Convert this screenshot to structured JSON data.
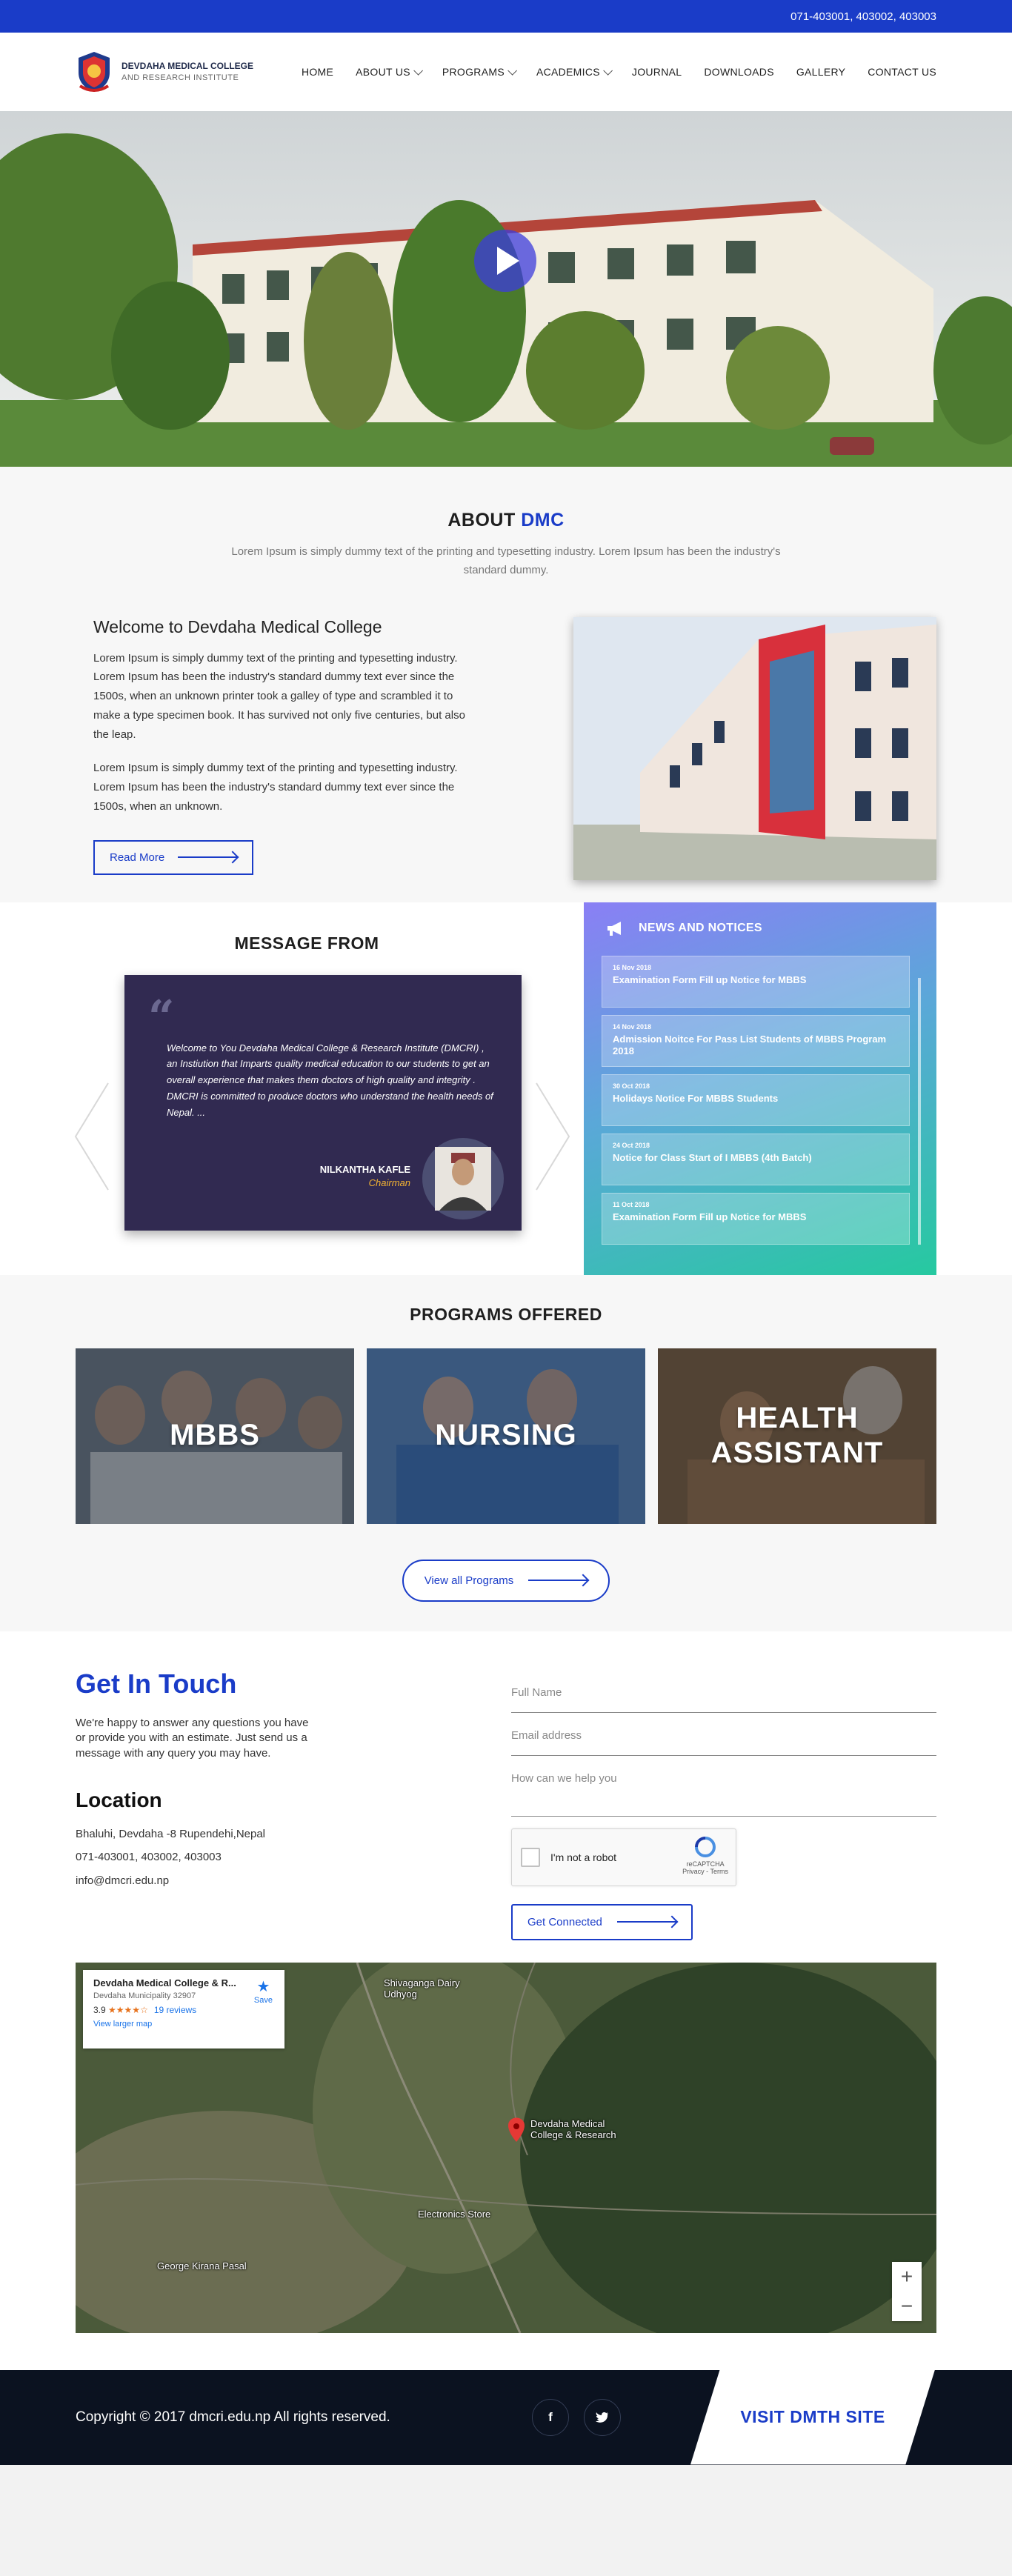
{
  "topbar": {
    "phone": "071-403001, 403002, 403003"
  },
  "header": {
    "logo_line1": "DEVDAHA MEDICAL COLLEGE",
    "logo_line2": "AND RESEARCH INSTITUTE",
    "nav": [
      {
        "label": "HOME",
        "dropdown": false
      },
      {
        "label": "ABOUT US",
        "dropdown": true
      },
      {
        "label": "PROGRAMS",
        "dropdown": true
      },
      {
        "label": "ACADEMICS",
        "dropdown": true
      },
      {
        "label": "JOURNAL",
        "dropdown": false
      },
      {
        "label": "DOWNLOADS",
        "dropdown": false
      },
      {
        "label": "GALLERY",
        "dropdown": false
      },
      {
        "label": "CONTACT US",
        "dropdown": false
      }
    ]
  },
  "about": {
    "title_prefix": "ABOUT",
    "title_highlight": "DMC",
    "subtitle": "Lorem Ipsum is simply dummy text of the printing and typesetting industry. Lorem Ipsum has been the industry's standard dummy.",
    "heading": "Welcome to Devdaha Medical College",
    "para1": "Lorem Ipsum is simply dummy text of the printing and typesetting industry. Lorem Ipsum has been the industry's standard dummy text ever since the 1500s, when an unknown printer took a galley of type and scrambled it to make a type specimen book. It has survived not only five centuries, but also the leap.",
    "para2": "Lorem Ipsum is simply dummy text of the printing and typesetting industry. Lorem Ipsum has been the industry's standard dummy text ever since the 1500s, when an unknown.",
    "read_more": "Read More"
  },
  "message": {
    "title": "MESSAGE FROM",
    "quote": "Welcome to You Devdaha Medical College & Research Institute (DMCRI) , an Instiution that Imparts  quality medical education to our students to get an overall experience that makes them doctors of high quality and integrity . DMCRI is committed to produce doctors who understand the health needs of Nepal. ...",
    "name": "NILKANTHA KAFLE",
    "role": "Chairman"
  },
  "news": {
    "title": "NEWS AND NOTICES",
    "items": [
      {
        "date": "16 Nov 2018",
        "title": "Examination Form Fill up Notice for MBBS"
      },
      {
        "date": "14 Nov 2018",
        "title": "Admission Noitce For Pass List Students of MBBS Program 2018"
      },
      {
        "date": "30 Oct 2018",
        "title": "Holidays Notice For MBBS Students"
      },
      {
        "date": "24 Oct 2018",
        "title": "Notice for Class Start of I MBBS (4th Batch)"
      },
      {
        "date": "11 Oct 2018",
        "title": "Examination Form Fill up Notice for MBBS"
      }
    ]
  },
  "programs": {
    "title": "PROGRAMS OFFERED",
    "items": [
      {
        "label": "MBBS",
        "tint": "#2f3a4a"
      },
      {
        "label": "NURSING",
        "tint": "#2c4a6e"
      },
      {
        "label": "HEALTH ASSISTANT",
        "tint": "#3a3024"
      }
    ],
    "view_all": "View all Programs"
  },
  "contact": {
    "title": "Get In Touch",
    "intro": "We're happy to answer any questions you have or provide you with an estimate. Just send us a message with any query you may have.",
    "location_title": "Location",
    "address": "Bhaluhi, Devdaha -8 Rupendehi,Nepal",
    "phone": "071-403001, 403002, 403003",
    "email": "info@dmcri.edu.np",
    "form": {
      "name_placeholder": "Full Name",
      "email_placeholder": "Email address",
      "message_placeholder": "How can we help you",
      "captcha_label": "I'm not a robot",
      "captcha_brand": "reCAPTCHA",
      "captcha_links": "Privacy - Terms",
      "submit": "Get Connected"
    }
  },
  "map": {
    "place": "Devdaha Medical College & R...",
    "sub": "Devdaha Municipality 32907",
    "rating": "3.9",
    "stars": "★★★★☆",
    "reviews": "19 reviews",
    "larger": "View larger map",
    "save": "Save",
    "labels": [
      "Shivaganga Dairy Udhyog",
      "Devdaha Medical College & Research",
      "Electronics Store",
      "George Kirana Pasal"
    ]
  },
  "footer": {
    "copyright": "Copyright © 2017 dmcri.edu.np All rights reserved.",
    "visit": "VISIT  DMTH SITE",
    "social": [
      "f",
      "t"
    ]
  },
  "colors": {
    "brand_blue": "#1a3cc8",
    "footer": "#0b1220",
    "quote_bg": "#312a51"
  }
}
